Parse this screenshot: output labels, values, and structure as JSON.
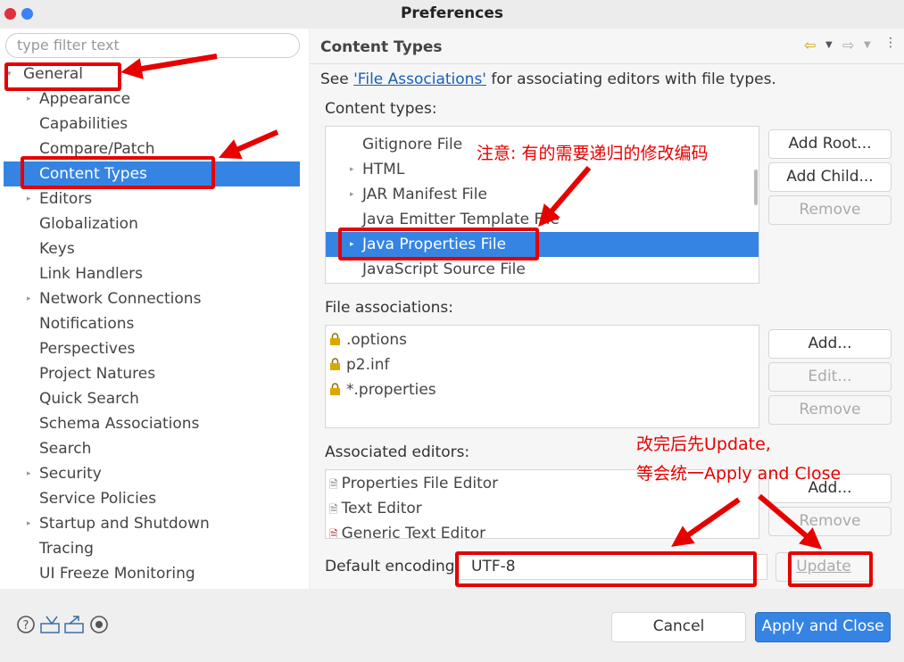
{
  "window": {
    "title": "Preferences"
  },
  "sidebar": {
    "filter_placeholder": "type filter text",
    "items": [
      {
        "label": "General"
      },
      {
        "label": "Appearance"
      },
      {
        "label": "Capabilities"
      },
      {
        "label": "Compare/Patch"
      },
      {
        "label": "Content Types"
      },
      {
        "label": "Editors"
      },
      {
        "label": "Globalization"
      },
      {
        "label": "Keys"
      },
      {
        "label": "Link Handlers"
      },
      {
        "label": "Network Connections"
      },
      {
        "label": "Notifications"
      },
      {
        "label": "Perspectives"
      },
      {
        "label": "Project Natures"
      },
      {
        "label": "Quick Search"
      },
      {
        "label": "Schema Associations"
      },
      {
        "label": "Search"
      },
      {
        "label": "Security"
      },
      {
        "label": "Service Policies"
      },
      {
        "label": "Startup and Shutdown"
      },
      {
        "label": "Tracing"
      },
      {
        "label": "UI Freeze Monitoring"
      }
    ]
  },
  "page": {
    "title": "Content Types",
    "desc_prefix": "See ",
    "desc_link": "'File Associations'",
    "desc_suffix": " for associating editors with file types.",
    "content_types_label": "Content types:",
    "content_types": [
      {
        "label": "Gitignore File"
      },
      {
        "label": "HTML"
      },
      {
        "label": "JAR Manifest File"
      },
      {
        "label": "Java Emitter Template File"
      },
      {
        "label": "Java Properties File"
      },
      {
        "label": "JavaScript Source File"
      }
    ],
    "file_assoc_label": "File associations:",
    "file_assocs": [
      {
        "label": ".options"
      },
      {
        "label": "p2.inf"
      },
      {
        "label": "*.properties"
      }
    ],
    "assoc_editors_label": "Associated editors:",
    "assoc_editors": [
      {
        "label": "Properties File Editor"
      },
      {
        "label": "Text Editor"
      },
      {
        "label": "Generic Text Editor"
      }
    ],
    "default_encoding_label": "Default encoding:",
    "default_encoding_value": "UTF-8",
    "buttons": {
      "add_root": "Add Root...",
      "add_child": "Add Child...",
      "remove1": "Remove",
      "add_assoc": "Add...",
      "edit_assoc": "Edit...",
      "remove2": "Remove",
      "add_editor": "Add...",
      "remove3": "Remove",
      "update": "Update"
    }
  },
  "footer": {
    "cancel": "Cancel",
    "apply_close": "Apply and Close"
  },
  "annotations": {
    "note1": "注意: 有的需要递归的修改编码",
    "note2_line1": "改完后先Update,",
    "note2_line2": "等会统一Apply and Close"
  },
  "colors": {
    "selection": "#3584e4",
    "annotation_red": "#e60000",
    "link": "#1a5fb4"
  }
}
